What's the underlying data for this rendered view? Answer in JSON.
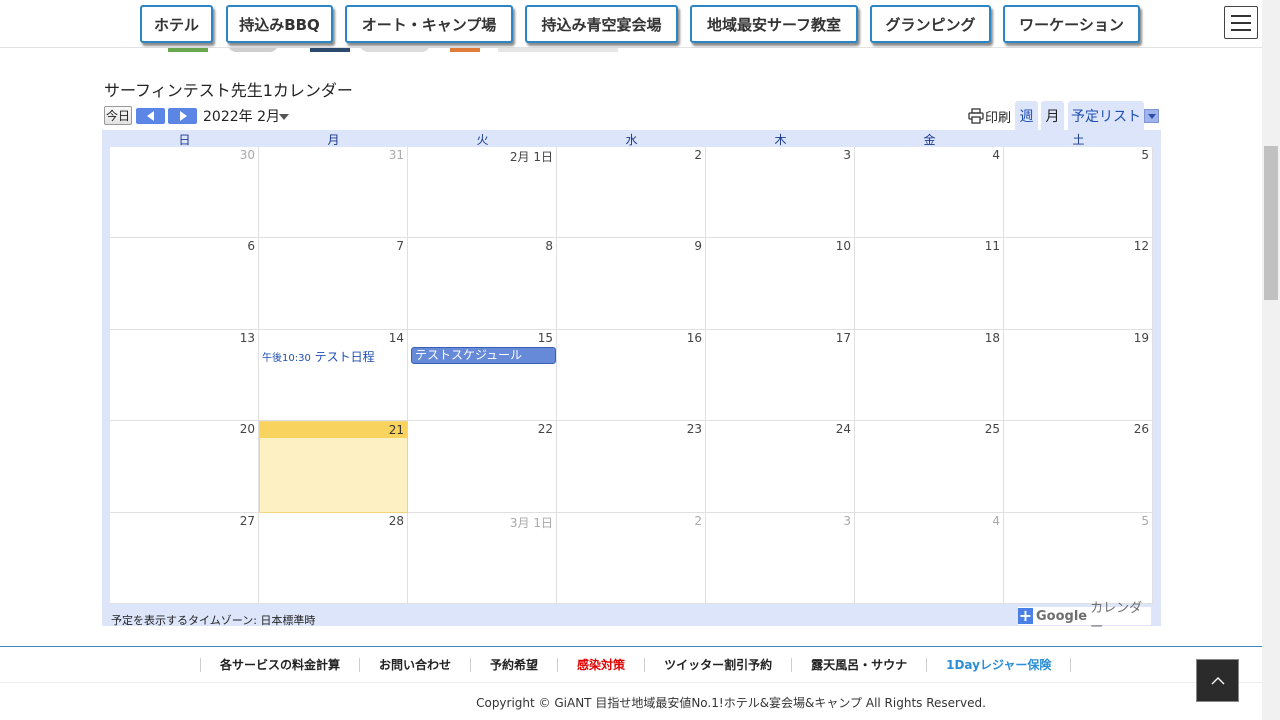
{
  "nav": {
    "items": [
      "ホテル",
      "持込みBBQ",
      "オート・キャンプ場",
      "持込み青空宴会場",
      "地域最安サーフ教室",
      "グランピング",
      "ワーケーション"
    ]
  },
  "calendar": {
    "title": "サーフィンテスト先生1カレンダー",
    "today_label": "今日",
    "month_label": "2022年 2月",
    "print_label": "印刷",
    "views": [
      "週",
      "月",
      "予定リスト"
    ],
    "day_headers": [
      "日",
      "月",
      "火",
      "水",
      "木",
      "金",
      "土"
    ],
    "weeks": [
      [
        {
          "d": "30",
          "dim": true
        },
        {
          "d": "31",
          "dim": true
        },
        {
          "d": "2月 1日"
        },
        {
          "d": "2"
        },
        {
          "d": "3"
        },
        {
          "d": "4"
        },
        {
          "d": "5"
        }
      ],
      [
        {
          "d": "6"
        },
        {
          "d": "7"
        },
        {
          "d": "8"
        },
        {
          "d": "9"
        },
        {
          "d": "10"
        },
        {
          "d": "11"
        },
        {
          "d": "12"
        }
      ],
      [
        {
          "d": "13"
        },
        {
          "d": "14"
        },
        {
          "d": "15"
        },
        {
          "d": "16"
        },
        {
          "d": "17"
        },
        {
          "d": "18"
        },
        {
          "d": "19"
        }
      ],
      [
        {
          "d": "20"
        },
        {
          "d": "21",
          "today": true
        },
        {
          "d": "22"
        },
        {
          "d": "23"
        },
        {
          "d": "24"
        },
        {
          "d": "25"
        },
        {
          "d": "26"
        }
      ],
      [
        {
          "d": "27"
        },
        {
          "d": "28"
        },
        {
          "d": "3月 1日",
          "dim": true
        },
        {
          "d": "2",
          "dim": true
        },
        {
          "d": "3",
          "dim": true
        },
        {
          "d": "4",
          "dim": true
        },
        {
          "d": "5",
          "dim": true
        }
      ]
    ],
    "events": {
      "event1_time": "午後10:30",
      "event1_title": "テスト日程",
      "event2_title": "テストスケジュール"
    },
    "timezone_label": "予定を表示するタイムゾーン: 日本標準時",
    "gcal_plus": "+",
    "gcal_google": "Google",
    "gcal_label": "カレンダー"
  },
  "footer": {
    "links": [
      {
        "label": "各サービスの料金計算",
        "color": "#222222"
      },
      {
        "label": "お問い合わせ",
        "color": "#222222"
      },
      {
        "label": "予約希望",
        "color": "#222222"
      },
      {
        "label": "感染対策",
        "color": "#e00000"
      },
      {
        "label": "ツイッター割引予約",
        "color": "#222222"
      },
      {
        "label": "露天風呂・サウナ",
        "color": "#222222"
      },
      {
        "label": "1Dayレジャー保険",
        "color": "#2a8fd6"
      }
    ],
    "copyright": "Copyright © GiANT 目指せ地域最安値No.1!ホテル&宴会場&キャンプ All Rights Reserved."
  },
  "colors": {
    "accent": "#5c86e6",
    "frame": "#dde5fb",
    "today": "#f8d35e",
    "nav_border": "#2a86c4"
  }
}
